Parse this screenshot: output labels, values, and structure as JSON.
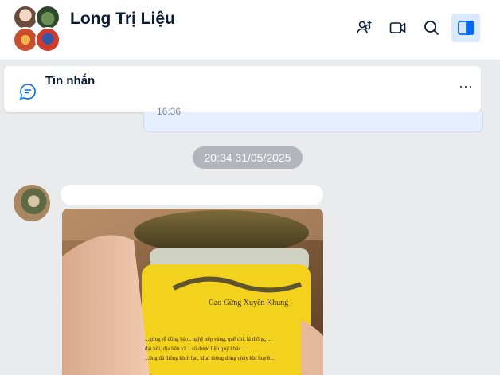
{
  "header": {
    "title": "Long Trị Liệu",
    "icons": [
      "add-member-icon",
      "video-call-icon",
      "search-icon",
      "sidebar-toggle-icon"
    ]
  },
  "pinned": {
    "label": "Tin nhắn",
    "more": "···",
    "icon": "chat-bubble-icon"
  },
  "conversation": {
    "previous_time": "16:36",
    "date_separator": "20:34 31/05/2025",
    "image_caption_line1": "Cao Gừng Xuyên Khung",
    "image_caption_line2": "...gừng rễ đồng bào , nghệ nếp vàng, quế chi, lá thông, ...",
    "image_caption_line3": "đại hồi, địa liền và 1 số dược liệu quý khác...",
    "image_caption_line4": "...ông đả thông kinh lạc, khai thông dòng chảy khí huyết..."
  },
  "colors": {
    "accent": "#0068ff",
    "active_bg": "#dbe9ff",
    "date_pill": "#b1b6bc",
    "jar_label": "#f2d21c"
  }
}
